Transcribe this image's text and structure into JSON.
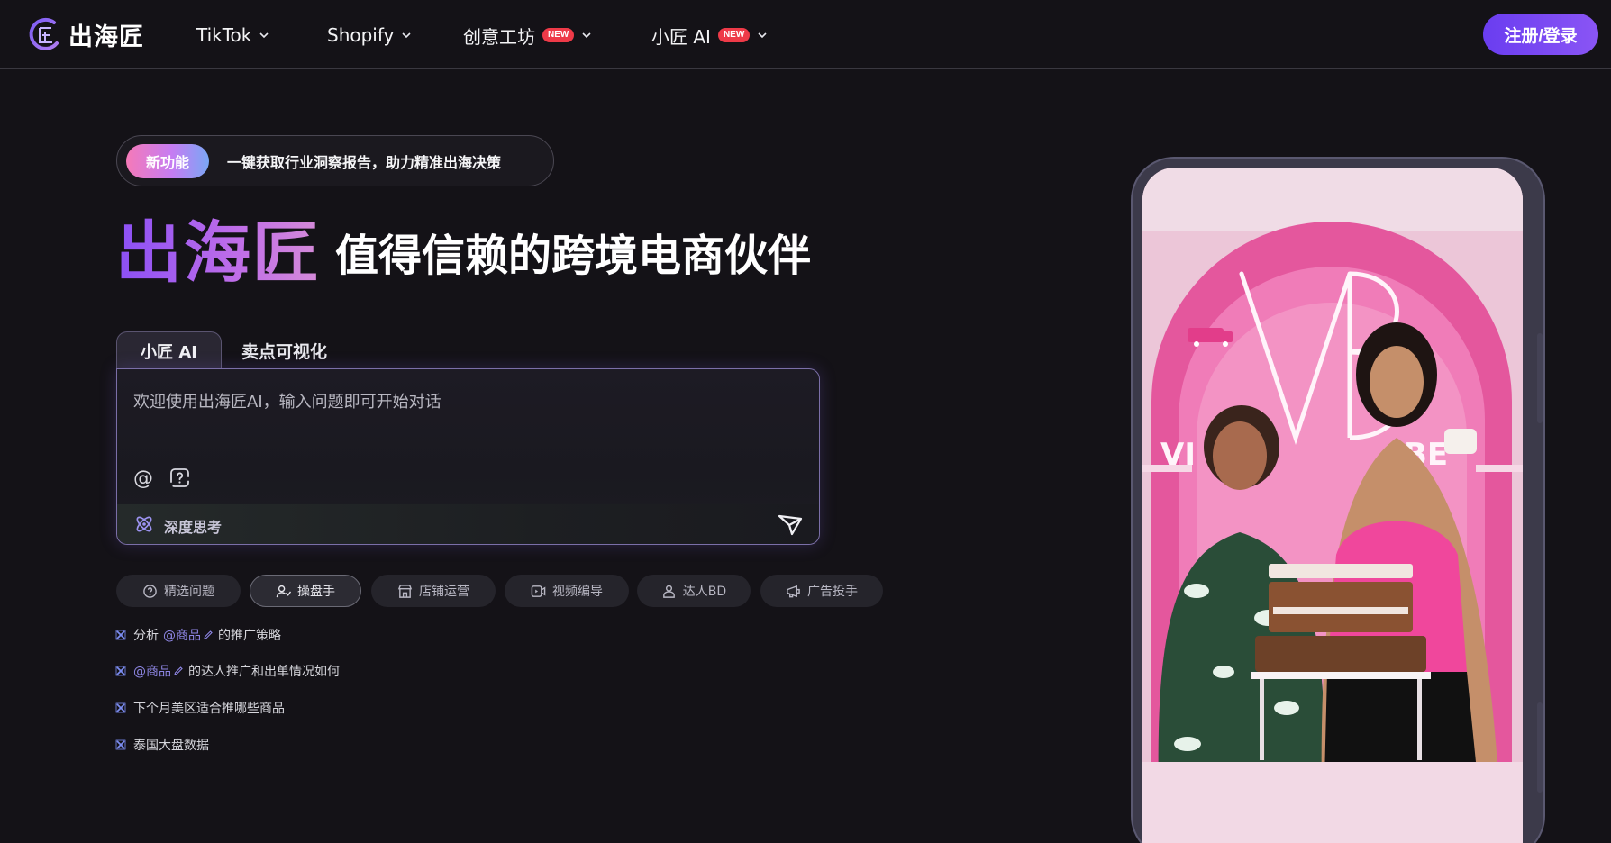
{
  "header": {
    "logo_text": "出海匠",
    "nav": [
      {
        "label": "TikTok",
        "badge": ""
      },
      {
        "label": "Shopify",
        "badge": ""
      },
      {
        "label": "创意工坊",
        "badge": "NEW"
      },
      {
        "label": "小匠 AI",
        "badge": "NEW"
      }
    ],
    "login_label": "注册/登录"
  },
  "promo": {
    "tag": "新功能",
    "text": "一键获取行业洞察报告，助力精准出海决策"
  },
  "hero": {
    "brand": "出海匠",
    "subtitle": "值得信赖的跨境电商伙伴"
  },
  "tabs": [
    {
      "label": "小匠 AI",
      "active": true
    },
    {
      "label": "卖点可视化",
      "active": false
    }
  ],
  "chat": {
    "placeholder": "欢迎使用出海匠AI，输入问题即可开始对话",
    "deep_think_label": "深度思考"
  },
  "chips": [
    {
      "label": "精选问题",
      "icon": "question-icon",
      "active": false
    },
    {
      "label": "操盘手",
      "icon": "user-icon",
      "active": true
    },
    {
      "label": "店铺运营",
      "icon": "store-icon",
      "active": false
    },
    {
      "label": "视频编导",
      "icon": "video-icon",
      "active": false
    },
    {
      "label": "达人BD",
      "icon": "people-icon",
      "active": false
    },
    {
      "label": "广告投手",
      "icon": "ad-icon",
      "active": false
    }
  ],
  "suggestions": {
    "s1_pre": "分析",
    "s1_prod": "@商品",
    "s1_post": "的推广策略",
    "s2_prod": "@商品",
    "s2_post": "的达人推广和出单情况如何",
    "s3": "下个月美区适合推哪些商品",
    "s4": "泰国大盘数据"
  },
  "colors": {
    "background": "#141217",
    "accent": "#7048f0",
    "badge": "#ee3a48"
  }
}
